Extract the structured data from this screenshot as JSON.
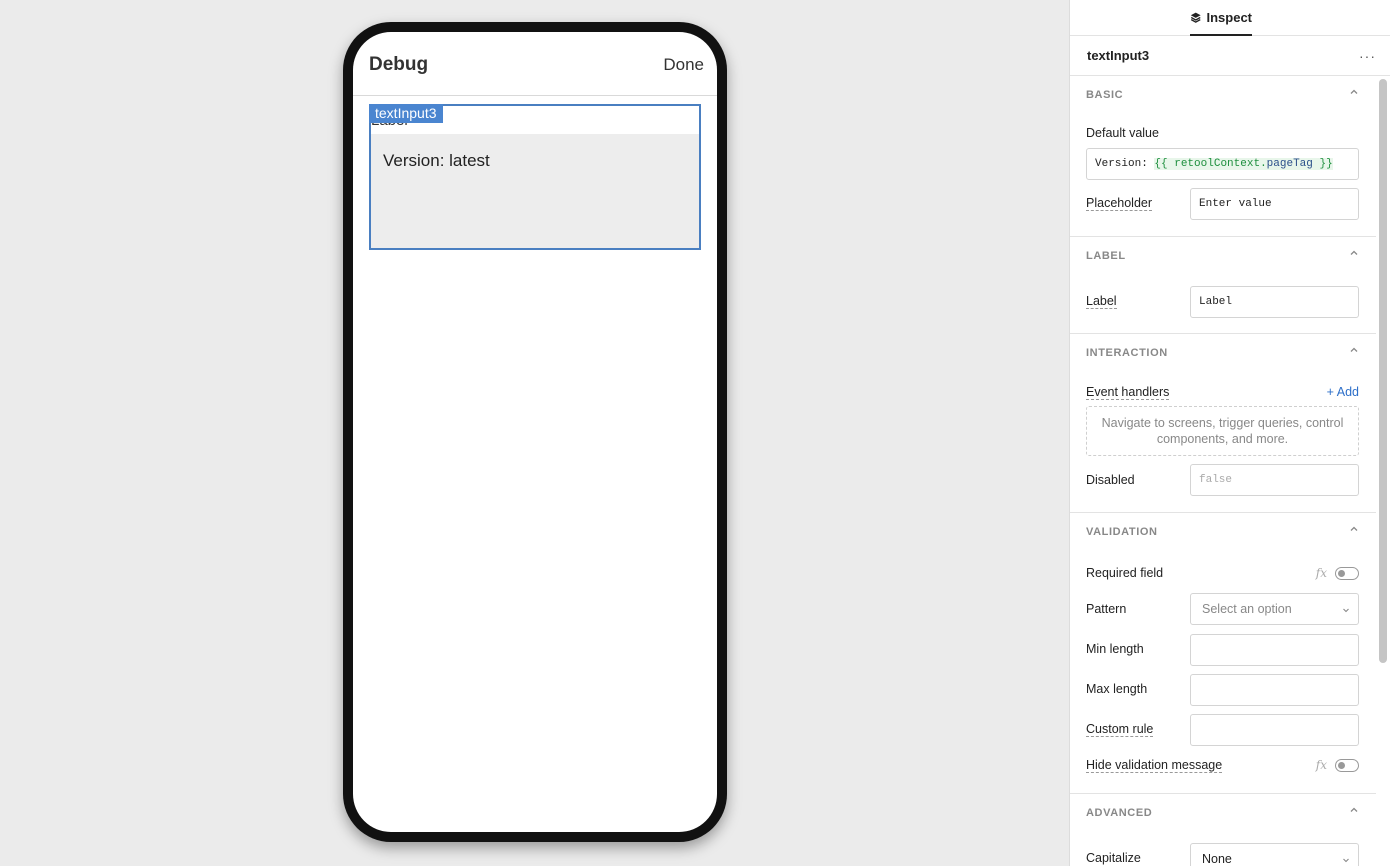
{
  "phone": {
    "title": "Debug",
    "done_label": "Done",
    "component_tag": "textInput3",
    "component_label": "Label",
    "component_value": "Version: latest"
  },
  "panel": {
    "tab_inspect": "Inspect",
    "component_name": "textInput3",
    "more": "···",
    "basic": {
      "title": "BASIC",
      "default_value_label": "Default value",
      "default_value_prefix": "Version: ",
      "default_value_open": "{{ ",
      "default_value_obj": "retoolContext",
      "default_value_dot": ".",
      "default_value_prop": "pageTag",
      "default_value_close": " }}",
      "placeholder_label": "Placeholder",
      "placeholder_value": "Enter value"
    },
    "label": {
      "title": "LABEL",
      "label_label": "Label",
      "label_value": "Label"
    },
    "interaction": {
      "title": "INTERACTION",
      "event_handlers_label": "Event handlers",
      "add_label": "+ Add",
      "event_hint": "Navigate to screens, trigger queries, control components, and more.",
      "disabled_label": "Disabled",
      "disabled_value": "false"
    },
    "validation": {
      "title": "VALIDATION",
      "required_label": "Required field",
      "pattern_label": "Pattern",
      "pattern_placeholder": "Select an option",
      "min_length_label": "Min length",
      "max_length_label": "Max length",
      "custom_rule_label": "Custom rule",
      "hide_message_label": "Hide validation message",
      "fx": "fx"
    },
    "advanced": {
      "title": "ADVANCED",
      "capitalize_label": "Capitalize",
      "capitalize_value": "None"
    }
  }
}
